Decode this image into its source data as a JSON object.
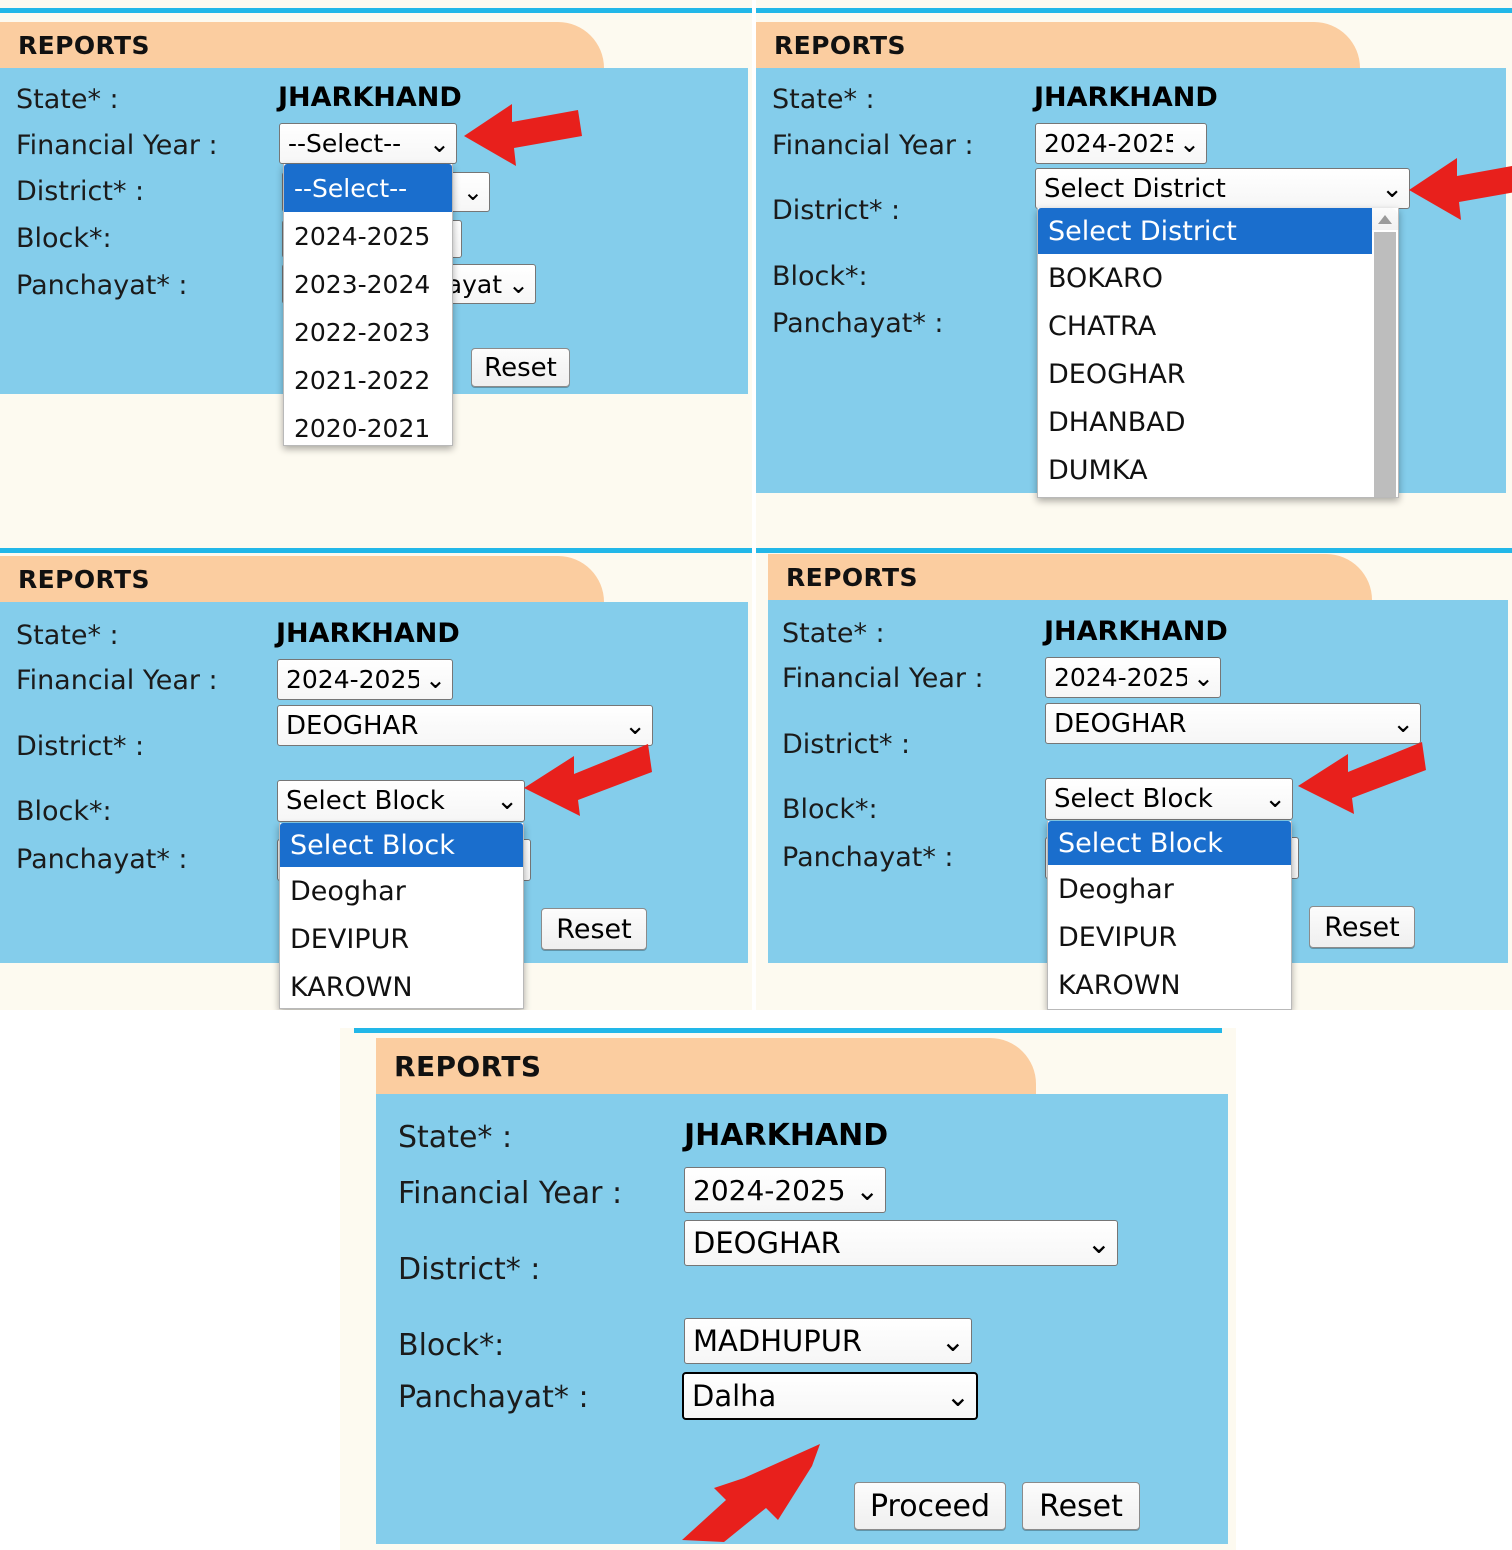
{
  "colors": {
    "card_header_bg": "#fbcda0",
    "card_body_bg": "#84cdeb",
    "rule_cyan": "#22b7e8",
    "dropdown_highlight": "#1a6ecd",
    "arrow_red": "#e8201c",
    "page_bg": "#fdfaf0"
  },
  "card_title": "REPORTS",
  "labels": {
    "state": "State* :",
    "financial_year": "Financial Year :",
    "district": "District* :",
    "block": "Block*:",
    "panchayat": "Panchayat* :"
  },
  "buttons": {
    "proceed": "Proceed",
    "reset": "Reset"
  },
  "icons": {
    "caret": "chevron-down-icon",
    "scroll_up": "scroll-up-arrow-icon",
    "pointer": "red-arrow-pointer-icon"
  },
  "panels": [
    {
      "id": "panel-1-financial-year-open",
      "title": "REPORTS",
      "state_value": "JHARKHAND",
      "financial_year": {
        "value": "--Select--",
        "open": true
      },
      "district": {
        "value": "",
        "open": false
      },
      "block": {
        "value": "",
        "open": false
      },
      "panchayat": {
        "value": "ayat",
        "open": false
      },
      "reset_label": "Reset",
      "open_list": {
        "field": "financial-year",
        "highlighted": "--Select--",
        "options": [
          "--Select--",
          "2024-2025",
          "2023-2024",
          "2022-2023",
          "2021-2022",
          "2020-2021"
        ]
      },
      "arrow_points_at": "financial-year-select"
    },
    {
      "id": "panel-2-district-open",
      "title": "REPORTS",
      "state_value": "JHARKHAND",
      "financial_year": {
        "value": "2024-2025",
        "open": false
      },
      "district": {
        "value": "Select District",
        "open": true
      },
      "block": {
        "value": "",
        "open": false
      },
      "panchayat": {
        "value": "",
        "open": false
      },
      "open_list": {
        "field": "district",
        "highlighted": "Select District",
        "scrollbar": true,
        "options": [
          "Select District",
          "BOKARO",
          "CHATRA",
          "DEOGHAR",
          "DHANBAD",
          "DUMKA"
        ]
      },
      "arrow_points_at": "district-select"
    },
    {
      "id": "panel-3-block-open",
      "title": "REPORTS",
      "state_value": "JHARKHAND",
      "financial_year": {
        "value": "2024-2025",
        "open": false
      },
      "district": {
        "value": "DEOGHAR",
        "open": false
      },
      "block": {
        "value": "Select Block",
        "open": true
      },
      "panchayat": {
        "value": "",
        "open": false
      },
      "reset_label": "Reset",
      "open_list": {
        "field": "block",
        "highlighted": "Select Block",
        "options": [
          "Select Block",
          "Deoghar",
          "DEVIPUR",
          "KAROWN"
        ]
      },
      "arrow_points_at": "block-select"
    },
    {
      "id": "panel-4-block-open-duplicate",
      "title": "REPORTS",
      "state_value": "JHARKHAND",
      "financial_year": {
        "value": "2024-2025",
        "open": false
      },
      "district": {
        "value": "DEOGHAR",
        "open": false
      },
      "block": {
        "value": "Select Block",
        "open": true
      },
      "panchayat": {
        "value": "",
        "open": false
      },
      "reset_label": "Reset",
      "open_list": {
        "field": "block",
        "highlighted": "Select Block",
        "options": [
          "Select Block",
          "Deoghar",
          "DEVIPUR",
          "KAROWN"
        ]
      },
      "arrow_points_at": "block-select"
    },
    {
      "id": "panel-5-complete",
      "title": "REPORTS",
      "state_value": "JHARKHAND",
      "financial_year": {
        "value": "2024-2025",
        "open": false
      },
      "district": {
        "value": "DEOGHAR",
        "open": false
      },
      "block": {
        "value": "MADHUPUR",
        "open": false
      },
      "panchayat": {
        "value": "Dalha",
        "open": false,
        "focused": true
      },
      "proceed_label": "Proceed",
      "reset_label": "Reset",
      "arrow_points_at": "proceed-button"
    }
  ]
}
